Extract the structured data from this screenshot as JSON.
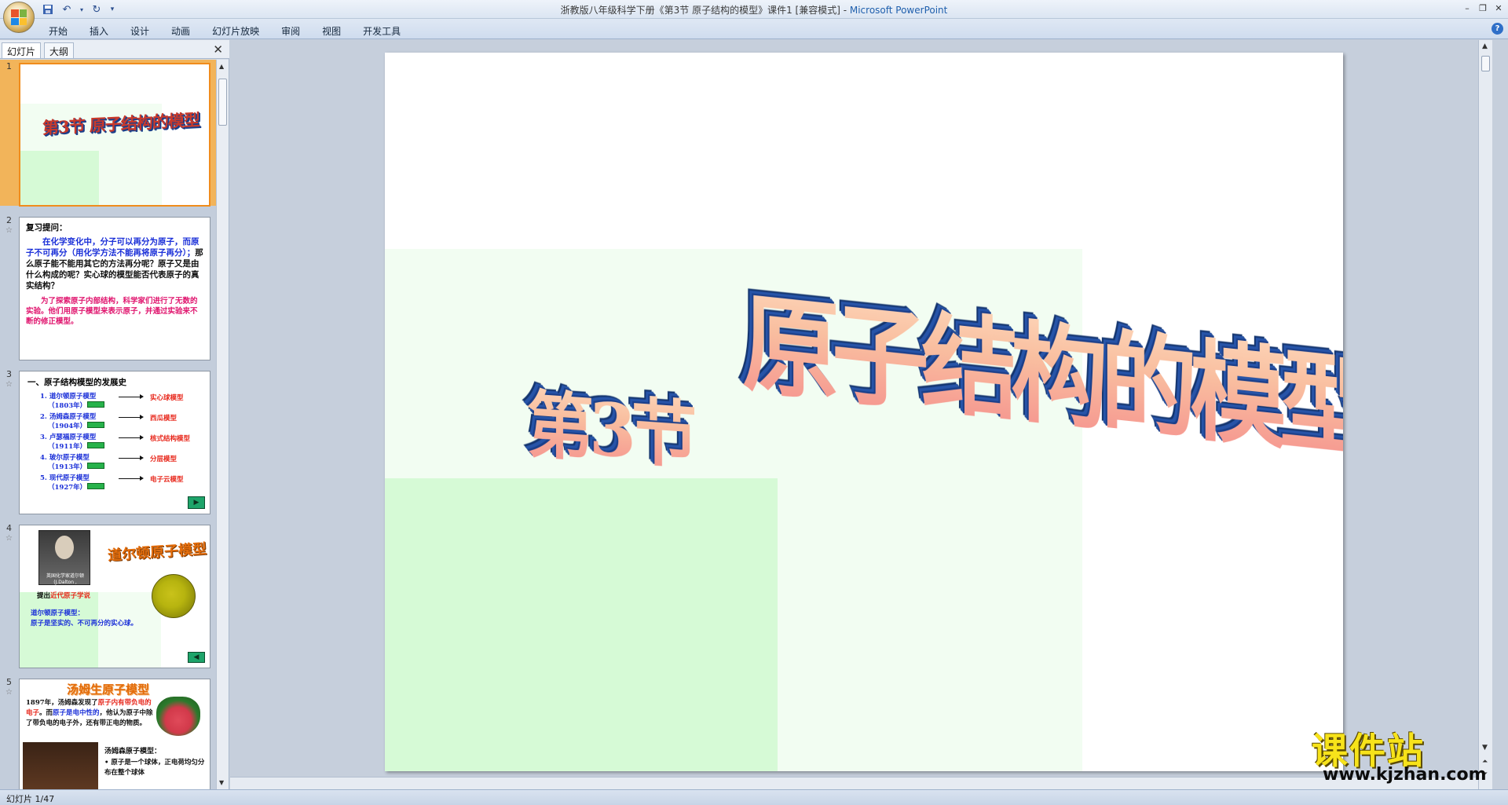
{
  "window": {
    "title": "浙教版八年级科学下册《第3节 原子结构的模型》课件1 [兼容模式] - ",
    "app_name": "Microsoft PowerPoint"
  },
  "ribbon": {
    "tabs": [
      "开始",
      "插入",
      "设计",
      "动画",
      "幻灯片放映",
      "审阅",
      "视图",
      "开发工具"
    ]
  },
  "left_pane": {
    "tab_slides": "幻灯片",
    "tab_outline": "大纲"
  },
  "thumbnails": {
    "s1": {
      "num": "1",
      "title": "第3节  原子结构的模型"
    },
    "s2": {
      "num": "2",
      "heading": "复习提问：",
      "p1_blue": "在化学变化中，分子可以再分为原子，而原子不可再分（用化学方法不能再将原子再分）；",
      "p1_black": "那么原子能不能用其它的方法再分呢？原子又是由什么构成的呢？实心球的模型能否代表原子的真实结构？",
      "p2": "为了探索原子内部结构，科学家们进行了无数的实验。他们用原子模型来表示原子，并通过实验来不断的修正模型。"
    },
    "s3": {
      "num": "3",
      "heading": "一、原子结构模型的发展史",
      "rows": [
        {
          "name": "1. 道尔顿原子模型",
          "year": "（1803年）",
          "result": "实心球模型"
        },
        {
          "name": "2. 汤姆森原子模型",
          "year": "（1904年）",
          "result": "西瓜模型"
        },
        {
          "name": "3. 卢瑟福原子模型",
          "year": "（1911年）",
          "result": "核式结构模型"
        },
        {
          "name": "4. 玻尔原子模型",
          "year": "（1913年）",
          "result": "分层模型"
        },
        {
          "name": "5. 现代原子模型",
          "year": "（1927年）",
          "result": "电子云模型"
        }
      ]
    },
    "s4": {
      "num": "4",
      "title": "道尔顿原子模型",
      "caption": "英国化学家道尔顿 (J.Dalton , 1766~1844)",
      "proposed_prefix": "提出",
      "proposed_red": "近代原子学说",
      "model_label": "道尔顿原子模型：",
      "model_desc": "原子是坚实的、不可再分的实心球。"
    },
    "s5": {
      "num": "5",
      "title": "汤姆生原子模型",
      "t_a": "1897年，汤姆森发现了",
      "t_red1": "原子内有带负电的电子",
      "t_b": "。而",
      "t_blue": "原子是电中性的",
      "t_c": "，他认为原子中除了带负电的电子外，还有带正电的物质。",
      "sub": "汤姆森原子模型：",
      "bullet": "• 原子是一个球体，正电荷均匀分布在整个球体"
    }
  },
  "slide": {
    "title_part1": "第3节",
    "title_part2": "原子结构的模型"
  },
  "watermark": {
    "cn": "课件站",
    "url": "www.kjzhan.com"
  },
  "status": {
    "slide_counter": "幻灯片 1/47"
  },
  "colors": {
    "accent_select": "#f2b45a",
    "wordart_edge": "#1b3f8a",
    "slide_green_light": "#f2fdf2",
    "slide_green": "#d6fad6"
  }
}
